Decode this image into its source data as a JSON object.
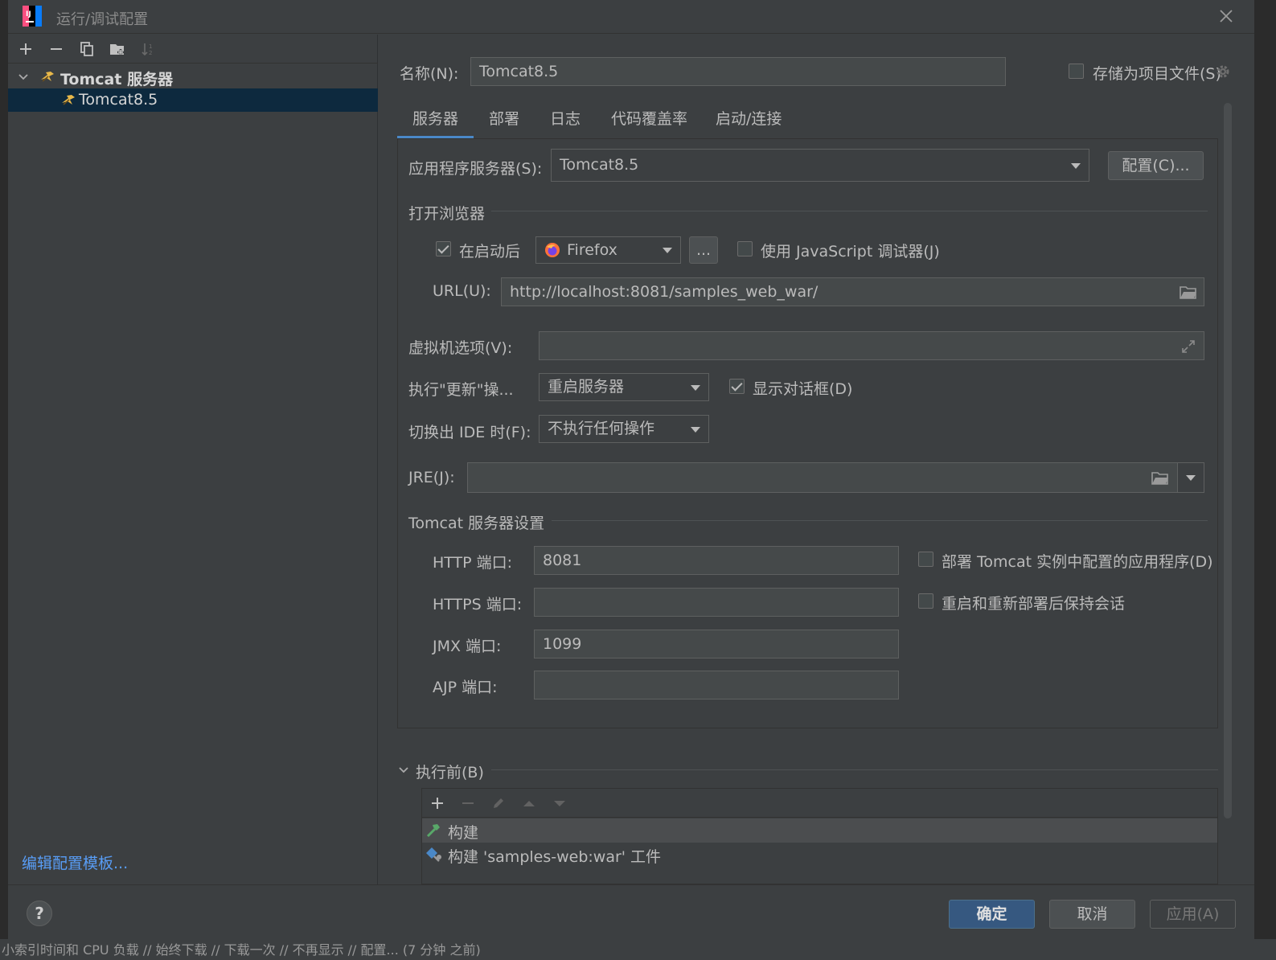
{
  "window": {
    "title": "运行/调试配置"
  },
  "left_toolbar": {
    "icons": [
      "add-icon",
      "remove-icon",
      "copy-icon",
      "folder-add-icon",
      "sort-icon"
    ]
  },
  "tree": {
    "group_label": "Tomcat 服务器",
    "item_label": "Tomcat8.5"
  },
  "edit_templates_link": "编辑配置模板...",
  "name_label": "名称(N):",
  "name_value": "Tomcat8.5",
  "store_as_project_label": "存储为项目文件(S)",
  "tabs": [
    "服务器",
    "部署",
    "日志",
    "代码覆盖率",
    "启动/连接"
  ],
  "server": {
    "app_server_label": "应用程序服务器(S):",
    "app_server_value": "Tomcat8.5",
    "configure_button": "配置(C)...",
    "open_browser_section": "打开浏览器",
    "after_launch_label": "在启动后",
    "after_launch_checked": true,
    "browser_value": "Firefox",
    "browse_button": "...",
    "js_debugger_label": "使用 JavaScript 调试器(J)",
    "js_debugger_checked": false,
    "url_label": "URL(U):",
    "url_value": "http://localhost:8081/samples_web_war/",
    "vm_options_label": "虚拟机选项(V):",
    "vm_options_value": "",
    "update_action_label": "执行\"更新\"操...",
    "update_action_value": "重启服务器",
    "show_dialog_label": "显示对话框(D)",
    "show_dialog_checked": true,
    "frame_deactivation_label": "切换出 IDE 时(F):",
    "frame_deactivation_value": "不执行任何操作",
    "jre_label": "JRE(J):",
    "jre_value": "",
    "tomcat_settings_section": "Tomcat 服务器设置",
    "http_port_label": "HTTP 端口:",
    "http_port_value": "8081",
    "https_port_label": "HTTPS 端口:",
    "https_port_value": "",
    "jmx_port_label": "JMX 端口:",
    "jmx_port_value": "1099",
    "ajp_port_label": "AJP 端口:",
    "ajp_port_value": "",
    "deploy_apps_label": "部署 Tomcat 实例中配置的应用程序(D)",
    "deploy_apps_checked": false,
    "preserve_sessions_label": "重启和重新部署后保持会话",
    "preserve_sessions_checked": false
  },
  "before_launch": {
    "label": "执行前(B)",
    "items": [
      "构建",
      "构建 'samples-web:war' 工件"
    ]
  },
  "buttons": {
    "ok": "确定",
    "cancel": "取消",
    "apply": "应用(A)",
    "help": "?"
  },
  "statusbar": {
    "text": "小索引时间和 CPU 负载 // 始终下载 // 下载一次 // 不再显示 // 配置... (7 分钟 之前)"
  },
  "colors": {
    "accent": "#4a88c7",
    "primary_button": "#365880",
    "link": "#589df6",
    "selection": "#0d293e"
  }
}
